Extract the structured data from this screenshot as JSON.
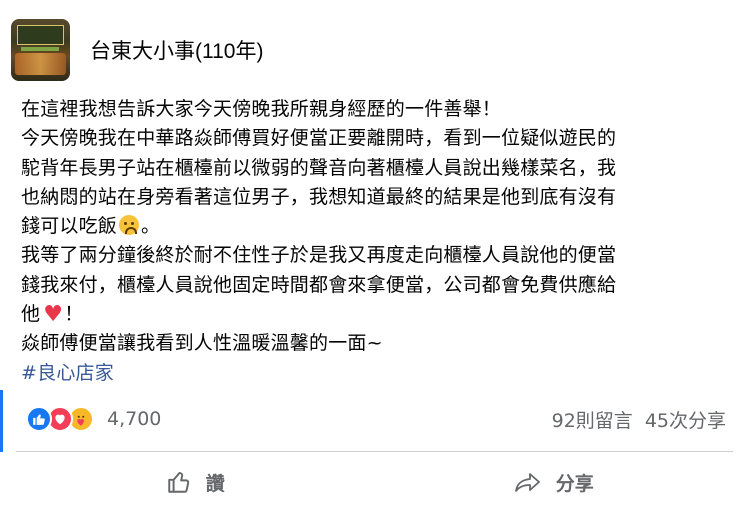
{
  "page": {
    "name": "台東大小事(110年)",
    "avatar_alt": "page-avatar"
  },
  "post": {
    "lines": [
      "在這裡我想告訴大家今天傍晚我所親身經歷的一件善舉！",
      "今天傍晚我在中華路焱師傅買好便當正要離開時，看到一位疑似遊民的",
      "駝背年長男子站在櫃檯前以微弱的聲音向著櫃檯人員說出幾樣菜名，我",
      "也納悶的站在身旁看著這位男子，我想知道最終的結果是他到底有沒有",
      "錢可以吃飯",
      "。",
      "我等了兩分鐘後終於耐不住性子於是我又再度走向櫃檯人員說他的便當",
      "錢我來付，櫃檯人員說他固定時間都會來拿便當，公司都會免費供應給",
      "他",
      "！",
      "焱師傅便當讓我看到人性溫暖溫馨的一面~"
    ],
    "hashtag": "#良心店家",
    "emoji": [
      "sad-face-emoji",
      "heart-emoji"
    ]
  },
  "stats": {
    "reactions": [
      "like",
      "love",
      "care"
    ],
    "reaction_count": "4,700",
    "comments": "92則留言",
    "shares": "45次分享"
  },
  "actions": {
    "like_label": "讚",
    "share_label": "分享"
  },
  "colors": {
    "like": "#1877f2",
    "love": "#f33e58",
    "care": "#f7b928",
    "hashtag": "#385898",
    "muted": "#65676b"
  }
}
